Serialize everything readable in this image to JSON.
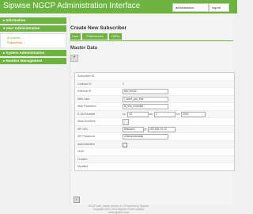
{
  "header": {
    "title": "Sipwise NGCP Administration Interface",
    "user_label": "administrator",
    "logout_label": "logout"
  },
  "sidebar": {
    "sections": [
      {
        "label": "Information"
      },
      {
        "label": "User Administration",
        "items": [
          {
            "label": "Accounts"
          },
          {
            "label": "Subscriber"
          }
        ]
      },
      {
        "label": "System Administration"
      },
      {
        "label": "Number Management"
      }
    ]
  },
  "main": {
    "title": "Create New Subscriber",
    "tabs": [
      {
        "label": "User"
      },
      {
        "label": "Preferences"
      },
      {
        "label": "CDRs"
      }
    ],
    "section_title": "Master Data",
    "expand_label": "+",
    "form": {
      "subscriber_id": {
        "label": "Subscriber ID",
        "value": ""
      },
      "contract_id": {
        "label": "Contract ID",
        "value": "2"
      },
      "external_id": {
        "label": "External ID",
        "value": "arp-crm-id"
      },
      "web_user": {
        "label": "Web User",
        "value": "i_want_you_this"
      },
      "web_password": {
        "label": "Web Password",
        "value": "is_this_example"
      },
      "e164": {
        "label": "E.164 Number",
        "cc": "43",
        "ac": "1",
        "sn": "2001"
      },
      "alias_numbers": {
        "label": "Alias Numbers"
      },
      "sip_uri": {
        "label": "SIP URI",
        "user": "testuser1",
        "domain": "192.168.10.10"
      },
      "sip_password": {
        "label": "SIP Password",
        "value": "othercredentials"
      },
      "administrative": {
        "label": "Administrative"
      },
      "uuid": {
        "label": "UUID",
        "value": ""
      },
      "created": {
        "label": "Created",
        "value": ""
      },
      "modified": {
        "label": "Modified",
        "value": ""
      }
    }
  },
  "footer": {
    "line1": "NGCP web_admin version 2.x | Powered by Sipwise",
    "line2": "Copyright 2007-2011 Sipwise GmbH Austria",
    "line3": "www.sipwise.com"
  }
}
